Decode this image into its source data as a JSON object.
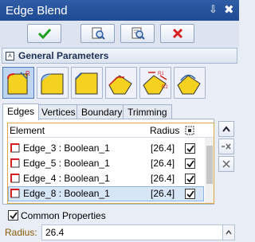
{
  "window": {
    "title": "Edge Blend",
    "pin_glyph": "⇩",
    "close_glyph": "✖"
  },
  "toolbar": {
    "buttons": [
      {
        "name": "ok-icon",
        "color": "#1e9e1e"
      },
      {
        "name": "preview-icon",
        "color": "#2f5da6"
      },
      {
        "name": "detail-preview-icon",
        "color": "#2f5da6"
      },
      {
        "name": "cancel-icon",
        "color": "#d61f1f"
      }
    ]
  },
  "section": {
    "label": "General Parameters",
    "collapse_glyph": "˄"
  },
  "tabs": [
    {
      "label": "Edges",
      "active": true
    },
    {
      "label": "Vertices",
      "active": false
    },
    {
      "label": "Boundary",
      "active": false
    },
    {
      "label": "Trimming",
      "active": false
    }
  ],
  "grid": {
    "headers": {
      "element": "Element",
      "radius": "Radius"
    },
    "rows": [
      {
        "element": "Edge_3 : Boolean_1",
        "radius": "[26.4]",
        "checked": true
      },
      {
        "element": "Edge_5 : Boolean_1",
        "radius": "[26.4]",
        "checked": true
      },
      {
        "element": "Edge_4 : Boolean_1",
        "radius": "[26.4]",
        "checked": true
      },
      {
        "element": "Edge_8 : Boolean_1",
        "radius": "[26.4]",
        "checked": true,
        "selected": true
      }
    ]
  },
  "common_properties": {
    "label": "Common Properties",
    "checked": true
  },
  "radius_field": {
    "label": "Radius:",
    "value": "26.4"
  },
  "colors": {
    "accent": "#2f5da6",
    "selection": "#d7e6f7",
    "highlight": "#e0a647"
  }
}
